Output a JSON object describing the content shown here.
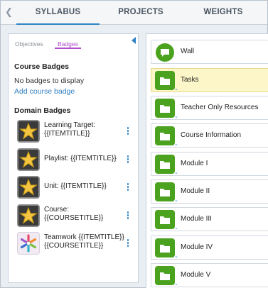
{
  "tabs": [
    {
      "label": "SYLLABUS",
      "active": true
    },
    {
      "label": "PROJECTS",
      "active": false
    },
    {
      "label": "WEIGHTS",
      "active": false
    }
  ],
  "left_panel": {
    "subtabs": [
      {
        "label": "Objectives",
        "active": false
      },
      {
        "label": "Badges",
        "active": true
      }
    ],
    "course_badges": {
      "title": "Course Badges",
      "empty_text": "No badges to display",
      "add_link": "Add course badge"
    },
    "domain_badges": {
      "title": "Domain Badges",
      "items": [
        {
          "label": "Learning Target: {{ITEMTITLE}}",
          "icon": "star-badge-icon"
        },
        {
          "label": "Playlist: {{ITEMTITLE}}",
          "icon": "star-badge-icon"
        },
        {
          "label": "Unit: {{ITEMTITLE}}",
          "icon": "star-badge-icon"
        },
        {
          "label": "Course: {{COURSETITLE}}",
          "icon": "star-badge-icon"
        },
        {
          "label": "Teamwork {{ITEMTITLE}} {{COURSETITLE}}",
          "icon": "teamwork-badge-icon"
        }
      ]
    }
  },
  "right_panel": {
    "items": [
      {
        "label": "Wall",
        "icon": "chat-bubble-icon",
        "highlighted": false
      },
      {
        "label": "Tasks",
        "icon": "folder-icon",
        "highlighted": true
      },
      {
        "label": "Teacher Only Resources",
        "icon": "folder-icon",
        "highlighted": false
      },
      {
        "label": "Course Information",
        "icon": "folder-icon",
        "highlighted": false
      },
      {
        "label": "Module I",
        "icon": "folder-icon",
        "highlighted": false
      },
      {
        "label": "Module II",
        "icon": "folder-icon",
        "highlighted": false
      },
      {
        "label": "Module III",
        "icon": "folder-icon",
        "highlighted": false
      },
      {
        "label": "Module IV",
        "icon": "folder-icon",
        "highlighted": false
      },
      {
        "label": "Module V",
        "icon": "folder-icon",
        "highlighted": false
      }
    ]
  },
  "colors": {
    "accent": "#2f83c4",
    "badges_tab": "#b04cc8",
    "folder_green": "#4aa21f",
    "highlight": "#fdf6c9"
  }
}
